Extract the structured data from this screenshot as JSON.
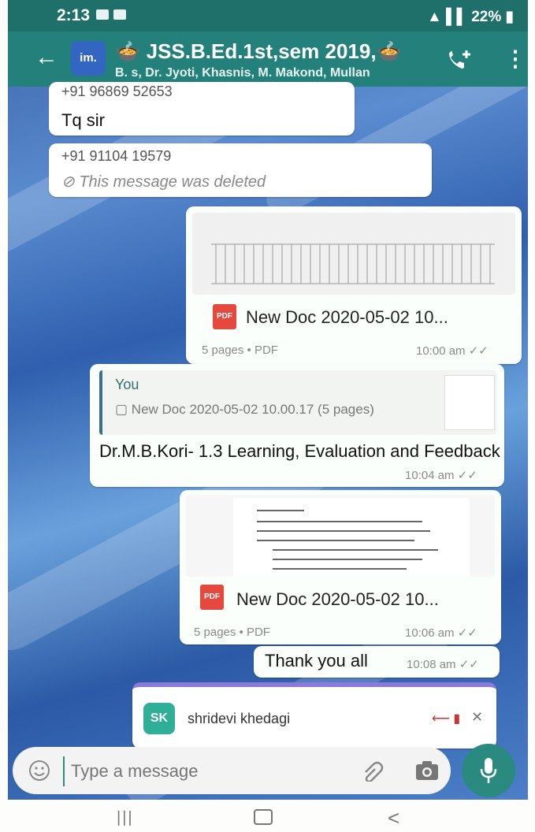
{
  "status_bar": {
    "time": "2:13",
    "right_text": "22%"
  },
  "app_bar": {
    "avatar_text": "im.",
    "group_title": "JSS.B.Ed.1st,sem 2019,",
    "members": "B. s, Dr. Jyoti, Khasnis, M. Makond, Mullan"
  },
  "messages": [
    {
      "sender": "+91 96869 52653",
      "text": "Tq sir"
    },
    {
      "sender": "+91 91104 19579",
      "text": "This message was deleted"
    }
  ],
  "doc1": {
    "name": "New Doc 2020-05-02 10...",
    "info": "5 pages • PDF",
    "time": "10:00 am"
  },
  "reply": {
    "quote_author": "You",
    "quote_text": "New Doc 2020-05-02 10.00.17 (5 pages)",
    "text": "Dr.M.B.Kori- 1.3 Learning, Evaluation and Feedback",
    "time": "10:04 am"
  },
  "doc2": {
    "name": "New Doc 2020-05-02 10...",
    "info": "5 pages • PDF",
    "time": "10:06 am"
  },
  "thanks": {
    "text": "Thank you all",
    "time": "10:08 am"
  },
  "contact_card": {
    "initials": "SK",
    "name": "shridevi khedagi"
  },
  "input": {
    "placeholder": "Type a message"
  },
  "colors": {
    "header": "#24807a",
    "accent": "#2a8a7f",
    "pdf": "#e5483c"
  }
}
